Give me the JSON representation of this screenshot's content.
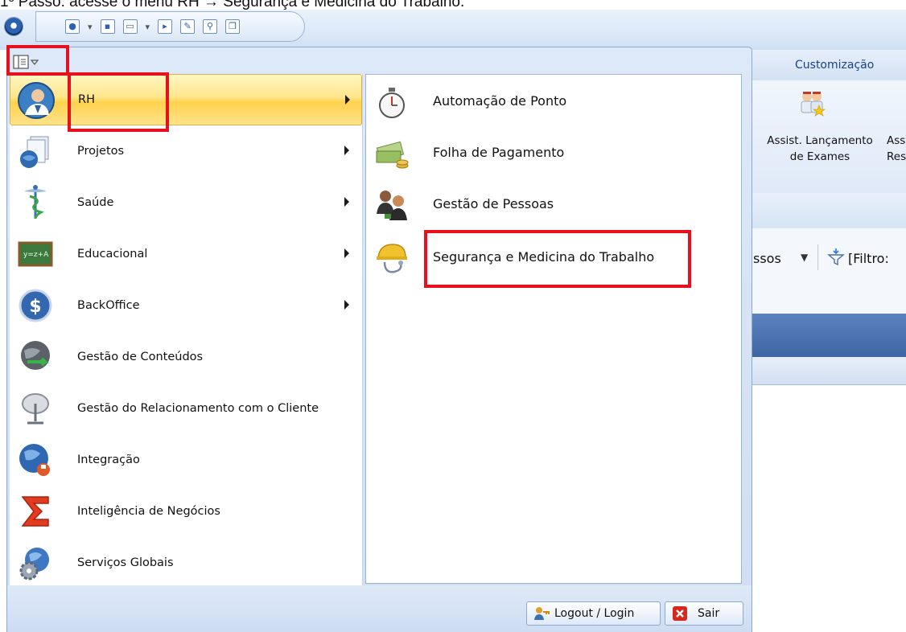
{
  "caption": "1º Passo: acesse o menu RH → Segurança e Medicina do Trabalho.",
  "ribbon": {
    "tab_label": "Customização",
    "button_label_line1": "Assist. Lançamento",
    "button_label_line2": "de Exames",
    "cut_label_line1": "Ass",
    "cut_label_line2": "Res"
  },
  "filter_bar": {
    "left_text": "ssos",
    "filter_text": "[Filtro:"
  },
  "menu": {
    "items": [
      {
        "label": "RH",
        "icon": "user-icon",
        "has_submenu": true,
        "selected": true
      },
      {
        "label": "Projetos",
        "icon": "projects-icon",
        "has_submenu": true
      },
      {
        "label": "Saúde",
        "icon": "caduceus-icon",
        "has_submenu": true
      },
      {
        "label": "Educacional",
        "icon": "chalkboard-icon",
        "has_submenu": true
      },
      {
        "label": "BackOffice",
        "icon": "dollar-icon",
        "has_submenu": true
      },
      {
        "label": "Gestão de Conteúdos",
        "icon": "globe-arrow-icon",
        "has_submenu": false
      },
      {
        "label": "Gestão do Relacionamento com o Cliente",
        "icon": "satellite-dish-icon",
        "has_submenu": false
      },
      {
        "label": "Integração",
        "icon": "globe-plug-icon",
        "has_submenu": false
      },
      {
        "label": "Inteligência de Negócios",
        "icon": "sigma-icon",
        "has_submenu": false
      },
      {
        "label": "Serviços Globais",
        "icon": "globe-gear-icon",
        "has_submenu": false
      }
    ],
    "submenu": [
      {
        "label": "Automação de Ponto",
        "icon": "stopwatch-icon"
      },
      {
        "label": "Folha de Pagamento",
        "icon": "money-icon"
      },
      {
        "label": "Gestão de Pessoas",
        "icon": "people-icon"
      },
      {
        "label": "Segurança e Medicina do Trabalho",
        "icon": "helmet-stethoscope-icon"
      }
    ],
    "footer": {
      "logout_label": "Logout / Login",
      "exit_label": "Sair"
    }
  },
  "colors": {
    "highlight_box": "#e8101c",
    "selected_item": "#ffd24d"
  }
}
